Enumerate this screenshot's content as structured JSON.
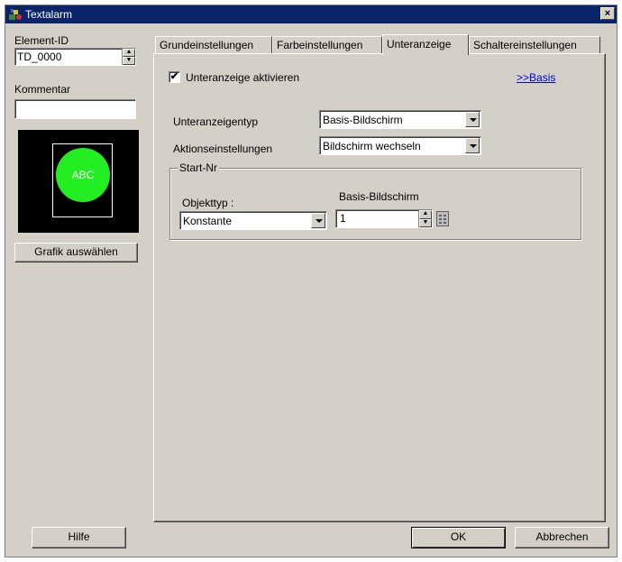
{
  "window": {
    "title": "Textalarm",
    "close": "×"
  },
  "left": {
    "element_id_label": "Element-ID",
    "element_id_value": "TD_0000",
    "comment_label": "Kommentar",
    "comment_value": "",
    "preview_text": "ABC",
    "preview_color": "#22ee22",
    "select_graphic_label": "Grafik auswählen",
    "help_label": "Hilfe"
  },
  "tabs": [
    {
      "label": "Grundeinstellungen"
    },
    {
      "label": "Farbeinstellungen"
    },
    {
      "label": "Unteranzeige"
    },
    {
      "label": "Schaltereinstellungen"
    }
  ],
  "panel": {
    "enable_sub_label": "Unteranzeige aktivieren",
    "enable_sub_checked": "✔",
    "basis_link": ">>Basis",
    "sub_type_label": "Unteranzeigentyp",
    "sub_type_value": "Basis-Bildschirm",
    "action_label": "Aktionseinstellungen",
    "action_value": "Bildschirm wechseln",
    "start_group_label": "Start-Nr",
    "object_type_label": "Objekttyp :",
    "object_type_value": "Konstante",
    "base_screen_label": "Basis-Bildschirm",
    "base_screen_value": "1"
  },
  "footer": {
    "ok_label": "OK",
    "cancel_label": "Abbrechen"
  }
}
